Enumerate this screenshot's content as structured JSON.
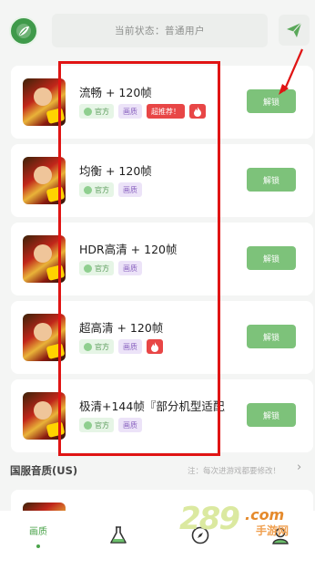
{
  "header": {
    "status_text": "当前状态：普通用户",
    "logo_icon": "lightning-leaf-icon",
    "send_icon": "paper-plane-icon"
  },
  "presets": [
    {
      "title": "流畅 + 120帧",
      "tag_official": "官方",
      "tag_quality": "画质",
      "tag_hot": "超推荐！",
      "has_fire": true,
      "button": "解锁"
    },
    {
      "title": "均衡 + 120帧",
      "tag_official": "官方",
      "tag_quality": "画质",
      "tag_hot": "",
      "has_fire": false,
      "button": "解锁"
    },
    {
      "title": "HDR高清 + 120帧",
      "tag_official": "官方",
      "tag_quality": "画质",
      "tag_hot": "",
      "has_fire": false,
      "button": "解锁"
    },
    {
      "title": "超高清 + 120帧",
      "tag_official": "官方",
      "tag_quality": "画质",
      "tag_hot": "",
      "has_fire": true,
      "button": "解锁"
    },
    {
      "title": "极清+144帧『部分机型适配』",
      "tag_official": "官方",
      "tag_quality": "画质",
      "tag_hot": "",
      "has_fire": false,
      "button": "解锁"
    }
  ],
  "section": {
    "title": "国服音质(US)",
    "note": "注：每次进游戏都要修改！",
    "chevron": "›"
  },
  "bottom_nav": {
    "items": [
      {
        "label": "画质",
        "icon": "",
        "active": true
      },
      {
        "label": "",
        "icon": "flask-icon",
        "active": false
      },
      {
        "label": "",
        "icon": "compass-icon",
        "active": false
      },
      {
        "label": "",
        "icon": "user-icon",
        "active": false
      }
    ]
  },
  "watermark": {
    "number": "289",
    "domain": ".com",
    "subtitle": "手游网"
  },
  "colors": {
    "accent_green": "#7dc27a",
    "hot_red": "#e84646",
    "annotation_red": "#e01414"
  }
}
